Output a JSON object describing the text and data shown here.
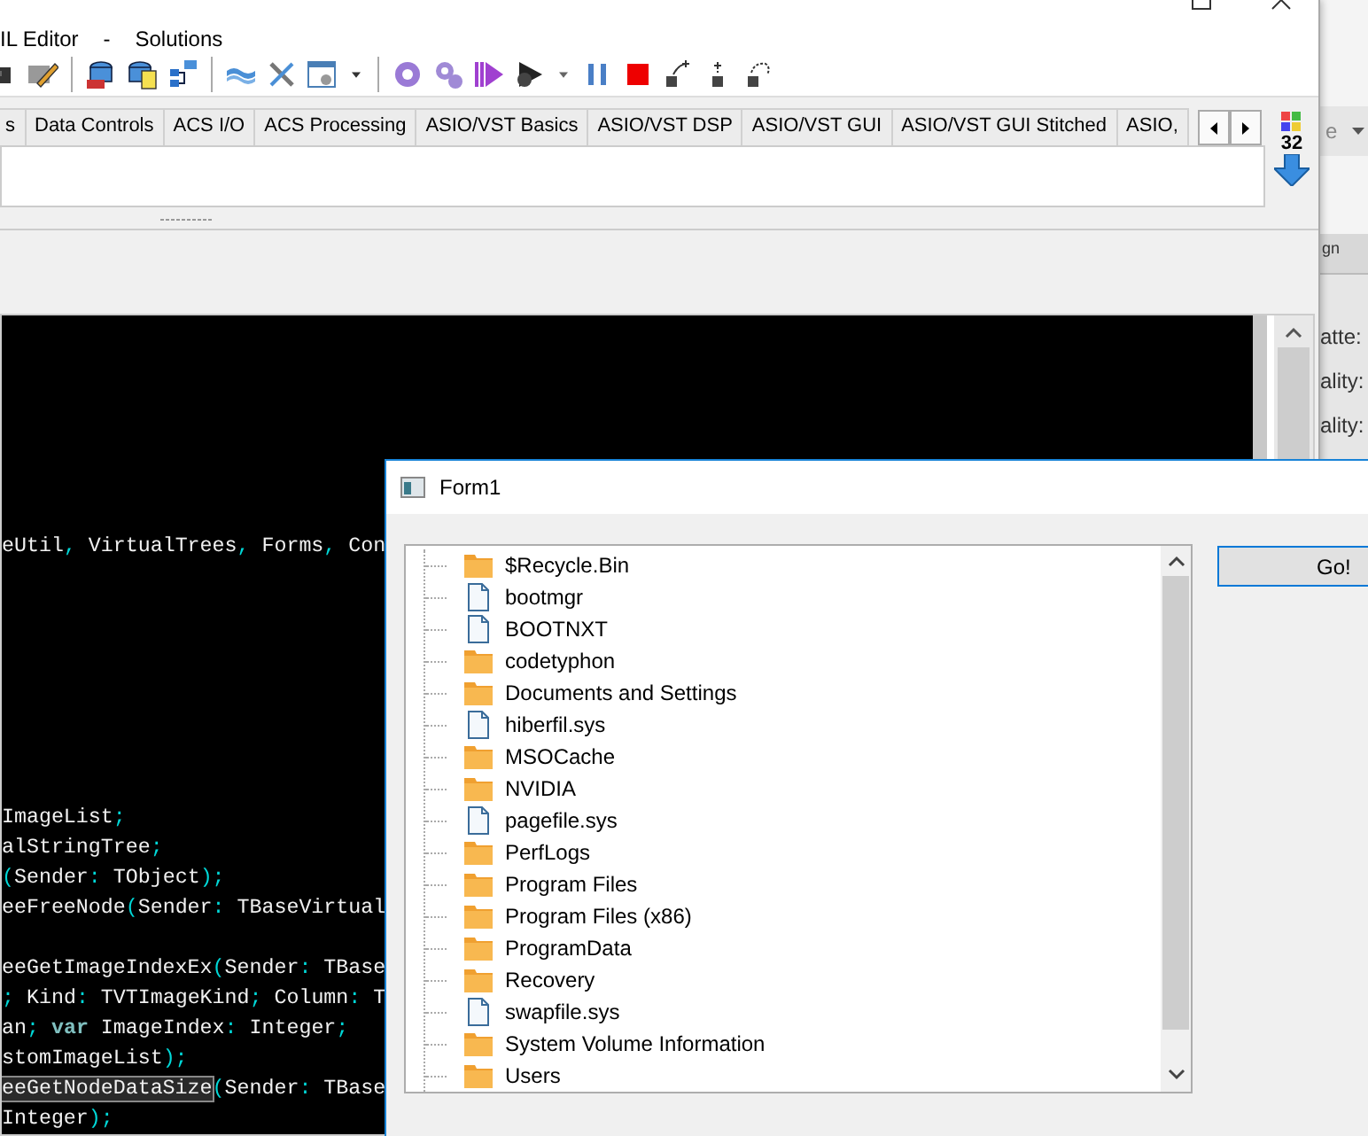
{
  "ide": {
    "menu": [
      {
        "label": "IL Editor"
      },
      {
        "label": "-"
      },
      {
        "label": "Solutions"
      }
    ],
    "palette_tabs": [
      {
        "label": "s",
        "selected": false
      },
      {
        "label": "Data Controls",
        "selected": false
      },
      {
        "label": "ACS I/O",
        "selected": false
      },
      {
        "label": "ACS Processing",
        "selected": false
      },
      {
        "label": "ASIO/VST Basics",
        "selected": false
      },
      {
        "label": "ASIO/VST DSP",
        "selected": false
      },
      {
        "label": "ASIO/VST GUI",
        "selected": false
      },
      {
        "label": "ASIO/VST GUI Stitched",
        "selected": false
      },
      {
        "label": "ASIO,",
        "selected": false
      }
    ],
    "badge": "32",
    "code_lines": [
      {
        "kind": "blank"
      },
      {
        "kind": "blank"
      },
      {
        "kind": "blank"
      },
      {
        "kind": "blank"
      },
      {
        "kind": "blank"
      },
      {
        "kind": "blank"
      },
      {
        "kind": "blank"
      },
      {
        "kind": "code",
        "tokens": [
          {
            "kind": "text",
            "text": "eUtil"
          },
          {
            "kind": "symbol",
            "text": ","
          },
          {
            "kind": "text",
            "text": " VirtualTrees"
          },
          {
            "kind": "symbol",
            "text": ","
          },
          {
            "kind": "text",
            "text": " Forms"
          },
          {
            "kind": "symbol",
            "text": ","
          },
          {
            "kind": "text",
            "text": " Con"
          }
        ]
      },
      {
        "kind": "blank"
      },
      {
        "kind": "blank"
      },
      {
        "kind": "blank"
      },
      {
        "kind": "blank"
      },
      {
        "kind": "blank"
      },
      {
        "kind": "blank"
      },
      {
        "kind": "blank"
      },
      {
        "kind": "blank"
      },
      {
        "kind": "code",
        "tokens": [
          {
            "kind": "text",
            "text": "ImageList"
          },
          {
            "kind": "symbol",
            "text": ";"
          }
        ]
      },
      {
        "kind": "code",
        "tokens": [
          {
            "kind": "text",
            "text": "alStringTree"
          },
          {
            "kind": "symbol",
            "text": ";"
          }
        ]
      },
      {
        "kind": "code",
        "tokens": [
          {
            "kind": "symbol",
            "text": "("
          },
          {
            "kind": "text",
            "text": "Sender"
          },
          {
            "kind": "symbol",
            "text": ":"
          },
          {
            "kind": "text",
            "text": " TObject"
          },
          {
            "kind": "symbol",
            "text": ");"
          }
        ]
      },
      {
        "kind": "code",
        "tokens": [
          {
            "kind": "text",
            "text": "eeFreeNode"
          },
          {
            "kind": "symbol",
            "text": "("
          },
          {
            "kind": "text",
            "text": "Sender"
          },
          {
            "kind": "symbol",
            "text": ":"
          },
          {
            "kind": "text",
            "text": " TBaseVirtual"
          }
        ]
      },
      {
        "kind": "blank"
      },
      {
        "kind": "code",
        "tokens": [
          {
            "kind": "text",
            "text": "eeGetImageIndexEx"
          },
          {
            "kind": "symbol",
            "text": "("
          },
          {
            "kind": "text",
            "text": "Sender"
          },
          {
            "kind": "symbol",
            "text": ":"
          },
          {
            "kind": "text",
            "text": " TBase"
          }
        ]
      },
      {
        "kind": "code",
        "tokens": [
          {
            "kind": "symbol",
            "text": ";"
          },
          {
            "kind": "text",
            "text": " Kind"
          },
          {
            "kind": "symbol",
            "text": ":"
          },
          {
            "kind": "text",
            "text": " TVTImageKind"
          },
          {
            "kind": "symbol",
            "text": ";"
          },
          {
            "kind": "text",
            "text": " Column"
          },
          {
            "kind": "symbol",
            "text": ":"
          },
          {
            "kind": "text",
            "text": " T"
          }
        ]
      },
      {
        "kind": "code",
        "tokens": [
          {
            "kind": "text",
            "text": "an"
          },
          {
            "kind": "symbol",
            "text": ";"
          },
          {
            "kind": "keyword",
            "text": " var"
          },
          {
            "kind": "text",
            "text": " ImageIndex"
          },
          {
            "kind": "symbol",
            "text": ":"
          },
          {
            "kind": "text",
            "text": " Integer"
          },
          {
            "kind": "symbol",
            "text": ";"
          }
        ]
      },
      {
        "kind": "code",
        "tokens": [
          {
            "kind": "text",
            "text": "stomImageList"
          },
          {
            "kind": "symbol",
            "text": ");"
          }
        ]
      },
      {
        "kind": "code",
        "tokens": [
          {
            "kind": "highlight",
            "text": "eeGetNodeDataSize"
          },
          {
            "kind": "symbol",
            "text": "("
          },
          {
            "kind": "text",
            "text": "Sender"
          },
          {
            "kind": "symbol",
            "text": ":"
          },
          {
            "kind": "text",
            "text": " TBase"
          }
        ]
      },
      {
        "kind": "code",
        "tokens": [
          {
            "kind": "text",
            "text": "Integer"
          },
          {
            "kind": "symbol",
            "text": ");"
          }
        ]
      }
    ]
  },
  "background_window": {
    "dropdown": "e",
    "column_header": "gn",
    "labels": [
      "atte:",
      "ality:",
      "ality:"
    ]
  },
  "form1": {
    "title": "Form1",
    "tree": [
      {
        "kind": "folder",
        "label": "$Recycle.Bin",
        "selected": false
      },
      {
        "kind": "file",
        "label": "bootmgr",
        "selected": false
      },
      {
        "kind": "file",
        "label": "BOOTNXT",
        "selected": false
      },
      {
        "kind": "folder",
        "label": "codetyphon",
        "selected": false
      },
      {
        "kind": "folder",
        "label": "Documents and Settings",
        "selected": false
      },
      {
        "kind": "file",
        "label": "hiberfil.sys",
        "selected": false
      },
      {
        "kind": "folder",
        "label": "MSOCache",
        "selected": false
      },
      {
        "kind": "folder",
        "label": "NVIDIA",
        "selected": false
      },
      {
        "kind": "file",
        "label": "pagefile.sys",
        "selected": false
      },
      {
        "kind": "folder",
        "label": "PerfLogs",
        "selected": false
      },
      {
        "kind": "folder",
        "label": "Program Files",
        "selected": false
      },
      {
        "kind": "folder",
        "label": "Program Files (x86)",
        "selected": false
      },
      {
        "kind": "folder",
        "label": "ProgramData",
        "selected": false
      },
      {
        "kind": "folder",
        "label": "Recovery",
        "selected": false
      },
      {
        "kind": "file",
        "label": "swapfile.sys",
        "selected": false
      },
      {
        "kind": "folder",
        "label": "System Volume Information",
        "selected": false
      },
      {
        "kind": "folder",
        "label": "Users",
        "selected": false
      }
    ],
    "button": "Go!"
  }
}
